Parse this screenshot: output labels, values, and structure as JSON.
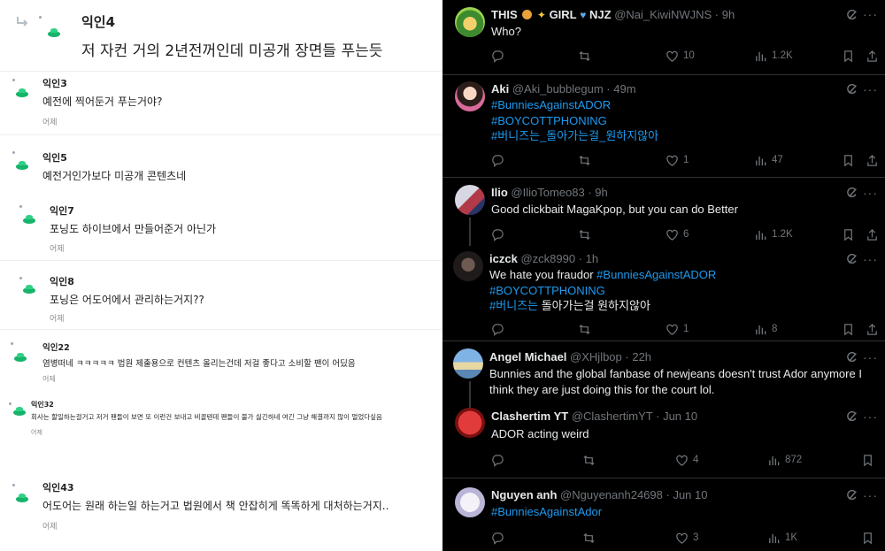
{
  "left": {
    "comments": [
      {
        "author": "익인4",
        "text": "저 자컨 거의 2년전꺼인데 미공개 장면들 푸는듯",
        "time": ""
      },
      {
        "author": "익인3",
        "text": "예전에 찍어둔거 푸는거야?",
        "time": "어제"
      },
      {
        "author": "익인5",
        "text": "예전거인가보다 미공개 콘텐츠네",
        "time": ""
      },
      {
        "author": "익인7",
        "text": "포닝도 하이브에서 만들어준거 아닌가",
        "time": "어제"
      },
      {
        "author": "익인8",
        "text": "포닝은 어도어에서 관리하는거지??",
        "time": "어제"
      },
      {
        "author": "익인22",
        "text": "염병떠네 ㅋㅋㅋㅋㅋ 법원 제출용으로 컨텐츠 올리는건데 저걸 좋다고 소비할 팬이 어딨음",
        "time": "어제"
      },
      {
        "author": "익인32",
        "text": "회사는 할일하는걸거고 저거 팬들이 보면 또 이런건 보내고 비꼴텐데 팬들이 불가 싫긴하네 여긴 그냥 해결까지 많이 멀었다싶음",
        "time": "어제"
      },
      {
        "author": "익인43",
        "text": "어도어는 원래 하는일 하는거고 법원에서 책 안잡히게 똑똑하게 대처하는거지..",
        "time": "어제"
      }
    ]
  },
  "tweets": [
    {
      "name": "THIS",
      "name_suffix": "GIRL",
      "name_suffix2": "NJZ",
      "handle": "@Nai_KiwiNWJNS",
      "time": "9h",
      "lines": [
        [
          {
            "t": "Who?"
          }
        ]
      ],
      "replies": "",
      "retweets": "",
      "likes": "10",
      "views": "1.2K"
    },
    {
      "name": "Aki",
      "handle": "@Aki_bubblegum",
      "time": "49m",
      "lines": [
        [
          {
            "t": "#BunniesAgainstADOR",
            "h": true
          }
        ],
        [
          {
            "t": "#BOYCOTTPHONING",
            "h": true
          }
        ],
        [
          {
            "t": "#버니즈는_돌아가는걸_원하지않아",
            "h": true
          }
        ]
      ],
      "replies": "",
      "retweets": "",
      "likes": "1",
      "views": "47"
    },
    {
      "name": "Ilio",
      "handle": "@IlioTomeo83",
      "time": "9h",
      "lines": [
        [
          {
            "t": "Good clickbait MagaKpop, but you can do Better"
          }
        ]
      ],
      "replies": "",
      "retweets": "",
      "likes": "6",
      "views": "1.2K"
    },
    {
      "name": "iczck",
      "handle": "@zck8990",
      "time": "1h",
      "lines": [
        [
          {
            "t": "We hate you fraudor "
          },
          {
            "t": "#BunniesAgainstADOR",
            "h": true
          }
        ],
        [
          {
            "t": "#BOYCOTTPHONING",
            "h": true
          }
        ],
        [
          {
            "t": "#버니즈는",
            "h": true
          },
          {
            "t": " 돌아가는걸 원하지않아"
          }
        ]
      ],
      "replies": "",
      "retweets": "",
      "likes": "1",
      "views": "8"
    },
    {
      "name": "Angel Michael",
      "handle": "@XHjlbop",
      "time": "22h",
      "lines": [
        [
          {
            "t": "Bunnies and the global fanbase of newjeans doesn't trust Ador anymore I"
          }
        ],
        [
          {
            "t": "think they are just doing this for the court lol."
          }
        ]
      ],
      "replies": "",
      "retweets": "",
      "likes": "",
      "views": ""
    },
    {
      "name": "Clashertim YT",
      "handle": "@ClashertimYT",
      "time": "Jun 10",
      "lines": [
        [
          {
            "t": "ADOR acting weird"
          }
        ]
      ],
      "replies": "",
      "retweets": "",
      "likes": "4",
      "views": "872"
    },
    {
      "name": "Nguyen anh",
      "handle": "@Nguyenanh24698",
      "time": "Jun 10",
      "lines": [
        [
          {
            "t": "#BunniesAgainstAdor",
            "h": true
          }
        ]
      ],
      "replies": "",
      "retweets": "",
      "likes": "3",
      "views": "1K"
    }
  ],
  "ui": {
    "separator": " · ",
    "more": "···"
  },
  "colors": {
    "link": "#1d9bf0",
    "muted": "#71767b",
    "forum_accent": "#16b36a"
  }
}
